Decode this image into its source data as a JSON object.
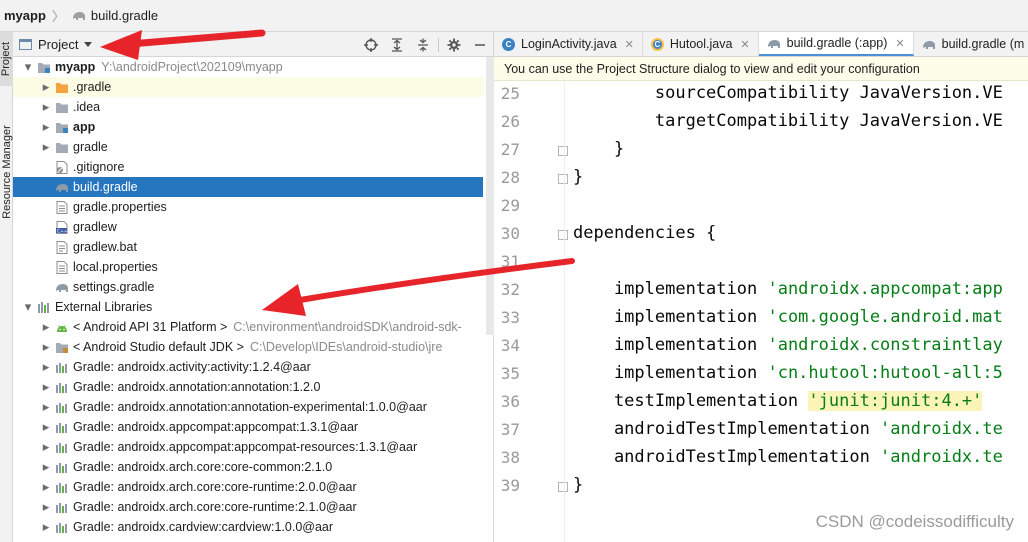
{
  "breadcrumb": {
    "root": "myapp",
    "file": "build.gradle"
  },
  "sidebar": {
    "project_tab": "Project",
    "resource_tab": "Resource Manager"
  },
  "panel": {
    "view_label": "Project"
  },
  "tree": [
    {
      "label": "myapp",
      "path": "Y:\\androidProject\\202109\\myapp",
      "icon": "module-folder-icon",
      "expanded": true,
      "indent": 0,
      "bold": true
    },
    {
      "label": ".gradle",
      "icon": "orange-folder-icon",
      "expanded": false,
      "indent": 1,
      "highlight": true
    },
    {
      "label": ".idea",
      "icon": "folder-icon",
      "expanded": false,
      "indent": 1
    },
    {
      "label": "app",
      "icon": "module-folder-icon",
      "expanded": false,
      "indent": 1,
      "bold": true
    },
    {
      "label": "gradle",
      "icon": "folder-icon",
      "expanded": false,
      "indent": 1
    },
    {
      "label": ".gitignore",
      "icon": "gitignore-file-icon",
      "indent": 1,
      "leaf": true
    },
    {
      "label": "build.gradle",
      "icon": "gradle-elephant-icon",
      "indent": 1,
      "leaf": true,
      "selected": true
    },
    {
      "label": "gradle.properties",
      "icon": "properties-file-icon",
      "indent": 1,
      "leaf": true
    },
    {
      "label": "gradlew",
      "icon": "script-file-icon",
      "indent": 1,
      "leaf": true
    },
    {
      "label": "gradlew.bat",
      "icon": "text-file-icon",
      "indent": 1,
      "leaf": true
    },
    {
      "label": "local.properties",
      "icon": "properties-file-icon",
      "indent": 1,
      "leaf": true
    },
    {
      "label": "settings.gradle",
      "icon": "gradle-elephant-icon",
      "indent": 1,
      "leaf": true
    },
    {
      "label": "External Libraries",
      "icon": "libraries-icon",
      "expanded": true,
      "indent": 0
    },
    {
      "label": "< Android API 31 Platform >",
      "path": "C:\\environment\\androidSDK\\android-sdk-",
      "icon": "android-icon",
      "expanded": false,
      "indent": 1
    },
    {
      "label": "< Android Studio default JDK >",
      "path": "C:\\Develop\\IDEs\\android-studio\\jre",
      "icon": "jdk-folder-icon",
      "expanded": false,
      "indent": 1
    },
    {
      "label": "Gradle: androidx.activity:activity:1.2.4@aar",
      "icon": "library-icon",
      "expanded": false,
      "indent": 1
    },
    {
      "label": "Gradle: androidx.annotation:annotation:1.2.0",
      "icon": "library-icon",
      "expanded": false,
      "indent": 1
    },
    {
      "label": "Gradle: androidx.annotation:annotation-experimental:1.0.0@aar",
      "icon": "library-icon",
      "expanded": false,
      "indent": 1
    },
    {
      "label": "Gradle: androidx.appcompat:appcompat:1.3.1@aar",
      "icon": "library-icon",
      "expanded": false,
      "indent": 1
    },
    {
      "label": "Gradle: androidx.appcompat:appcompat-resources:1.3.1@aar",
      "icon": "library-icon",
      "expanded": false,
      "indent": 1
    },
    {
      "label": "Gradle: androidx.arch.core:core-common:2.1.0",
      "icon": "library-icon",
      "expanded": false,
      "indent": 1
    },
    {
      "label": "Gradle: androidx.arch.core:core-runtime:2.0.0@aar",
      "icon": "library-icon",
      "expanded": false,
      "indent": 1
    },
    {
      "label": "Gradle: androidx.arch.core:core-runtime:2.1.0@aar",
      "icon": "library-icon",
      "expanded": false,
      "indent": 1
    },
    {
      "label": "Gradle: androidx.cardview:cardview:1.0.0@aar",
      "icon": "library-icon",
      "expanded": false,
      "indent": 1
    }
  ],
  "tabs": [
    {
      "label": "LoginActivity.java",
      "icon": "java-class-icon",
      "active": false
    },
    {
      "label": "Hutool.java",
      "icon": "java-class-icon",
      "active": false
    },
    {
      "label": "build.gradle (:app)",
      "icon": "gradle-elephant-icon",
      "active": true
    },
    {
      "label": "build.gradle (m",
      "icon": "gradle-elephant-icon",
      "active": false
    }
  ],
  "notice": "You can use the Project Structure dialog to view and edit your configuration",
  "code_lines": [
    {
      "num": "25",
      "parts": [
        {
          "t": "        sourceCompatibility JavaVersion.VE"
        }
      ]
    },
    {
      "num": "26",
      "parts": [
        {
          "t": "        targetCompatibility JavaVersion.VE"
        }
      ]
    },
    {
      "num": "27",
      "parts": [
        {
          "t": "    }"
        }
      ],
      "fold": true
    },
    {
      "num": "28",
      "parts": [
        {
          "t": "}"
        }
      ],
      "fold": true
    },
    {
      "num": "29",
      "parts": [
        {
          "t": ""
        }
      ]
    },
    {
      "num": "30",
      "parts": [
        {
          "t": "dependencies {"
        }
      ],
      "fold": true
    },
    {
      "num": "31",
      "parts": [
        {
          "t": ""
        }
      ]
    },
    {
      "num": "32",
      "parts": [
        {
          "t": "    implementation "
        },
        {
          "t": "'androidx.appcompat:app",
          "c": "str"
        }
      ]
    },
    {
      "num": "33",
      "parts": [
        {
          "t": "    implementation "
        },
        {
          "t": "'com.google.android.mat",
          "c": "str"
        }
      ]
    },
    {
      "num": "34",
      "parts": [
        {
          "t": "    implementation "
        },
        {
          "t": "'androidx.constraintlay",
          "c": "str"
        }
      ]
    },
    {
      "num": "35",
      "parts": [
        {
          "t": "    implementation "
        },
        {
          "t": "'cn.hutool:hutool-all:5",
          "c": "str"
        }
      ]
    },
    {
      "num": "36",
      "parts": [
        {
          "t": "    testImplementation "
        },
        {
          "t": "'junit:junit:4.+'",
          "c": "str str-hl"
        }
      ]
    },
    {
      "num": "37",
      "parts": [
        {
          "t": "    androidTestImplementation "
        },
        {
          "t": "'androidx.te",
          "c": "str"
        }
      ]
    },
    {
      "num": "38",
      "parts": [
        {
          "t": "    androidTestImplementation "
        },
        {
          "t": "'androidx.te",
          "c": "str"
        }
      ]
    },
    {
      "num": "39",
      "parts": [
        {
          "t": "}"
        }
      ],
      "fold": true
    }
  ],
  "watermark": "CSDN @codeissodifficulty",
  "colors": {
    "selection": "#2675bf",
    "string": "#067d17",
    "annotation_arrow": "#e8242b"
  }
}
